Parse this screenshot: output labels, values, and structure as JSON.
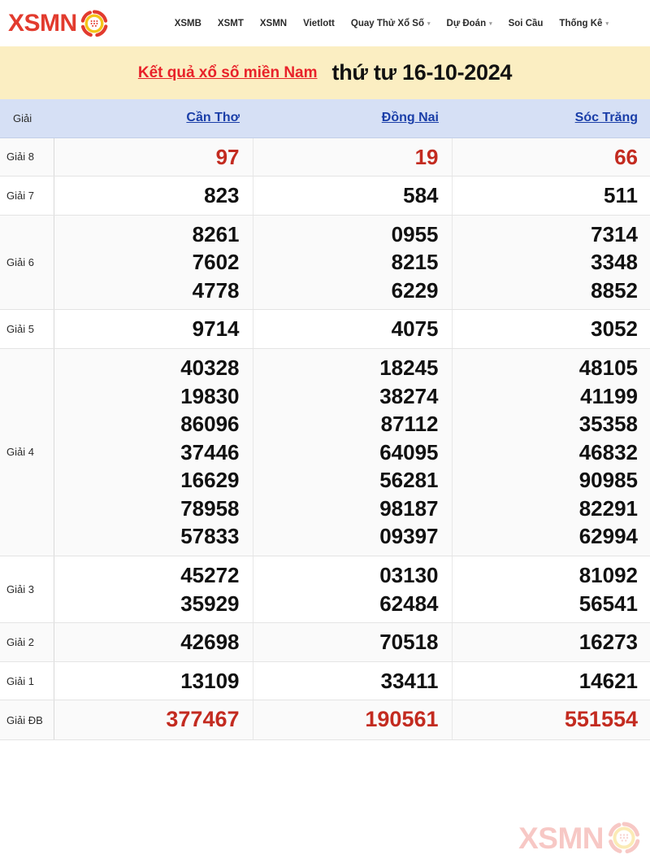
{
  "header": {
    "brand": "XSMN",
    "brand_color": "#e23b2e",
    "logo_icon": "lottery-ball-icon",
    "nav": [
      {
        "label": "XSMB",
        "has_dropdown": false
      },
      {
        "label": "XSMT",
        "has_dropdown": false
      },
      {
        "label": "XSMN",
        "has_dropdown": false
      },
      {
        "label": "Vietlott",
        "has_dropdown": false
      },
      {
        "label": "Quay Thử Xổ Số",
        "has_dropdown": true
      },
      {
        "label": "Dự Đoán",
        "has_dropdown": true
      },
      {
        "label": "Soi Cầu",
        "has_dropdown": false
      },
      {
        "label": "Thống Kê",
        "has_dropdown": true
      }
    ],
    "caret_glyph": "▾"
  },
  "banner": {
    "background": "#fbeec2",
    "link_text": "Kết quả xổ số miền Nam",
    "link_color": "#e8222a",
    "date_text": "thứ tư 16-10-2024"
  },
  "table": {
    "header_background": "#d6e0f5",
    "label_column_header": "Giải",
    "provinces": [
      "Cần Thơ",
      "Đồng Nai",
      "Sóc Trăng"
    ],
    "province_link_color": "#1a3ea8",
    "highlight_color": "#c32b20",
    "rows": [
      {
        "label": "Giải 8",
        "highlight": true,
        "values": [
          [
            "97"
          ],
          [
            "19"
          ],
          [
            "66"
          ]
        ]
      },
      {
        "label": "Giải 7",
        "highlight": false,
        "values": [
          [
            "823"
          ],
          [
            "584"
          ],
          [
            "511"
          ]
        ]
      },
      {
        "label": "Giải 6",
        "highlight": false,
        "values": [
          [
            "8261",
            "7602",
            "4778"
          ],
          [
            "0955",
            "8215",
            "6229"
          ],
          [
            "7314",
            "3348",
            "8852"
          ]
        ]
      },
      {
        "label": "Giải 5",
        "highlight": false,
        "values": [
          [
            "9714"
          ],
          [
            "4075"
          ],
          [
            "3052"
          ]
        ]
      },
      {
        "label": "Giải 4",
        "highlight": false,
        "values": [
          [
            "40328",
            "19830",
            "86096",
            "37446",
            "16629",
            "78958",
            "57833"
          ],
          [
            "18245",
            "38274",
            "87112",
            "64095",
            "56281",
            "98187",
            "09397"
          ],
          [
            "48105",
            "41199",
            "35358",
            "46832",
            "90985",
            "82291",
            "62994"
          ]
        ]
      },
      {
        "label": "Giải 3",
        "highlight": false,
        "values": [
          [
            "45272",
            "35929"
          ],
          [
            "03130",
            "62484"
          ],
          [
            "81092",
            "56541"
          ]
        ]
      },
      {
        "label": "Giải 2",
        "highlight": false,
        "values": [
          [
            "42698"
          ],
          [
            "70518"
          ],
          [
            "16273"
          ]
        ]
      },
      {
        "label": "Giải 1",
        "highlight": false,
        "values": [
          [
            "13109"
          ],
          [
            "33411"
          ],
          [
            "14621"
          ]
        ]
      },
      {
        "label": "Giải ĐB",
        "highlight": true,
        "values": [
          [
            "377467"
          ],
          [
            "190561"
          ],
          [
            "551554"
          ]
        ]
      }
    ]
  },
  "watermark": {
    "text": "XSMN",
    "icon": "lottery-ball-icon",
    "color": "#ef8780"
  }
}
